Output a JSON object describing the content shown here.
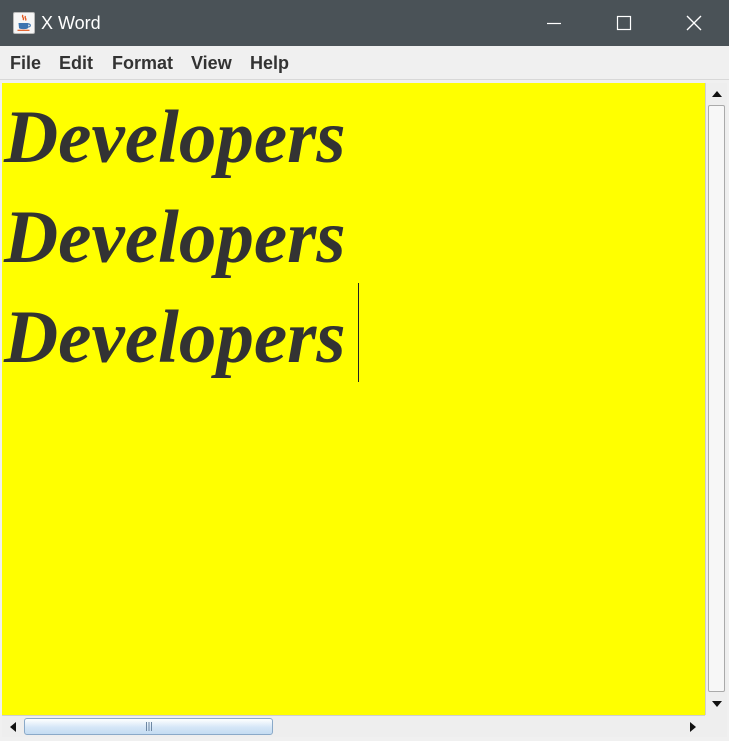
{
  "window": {
    "title": "X Word",
    "icon": "java-cup-icon"
  },
  "controls": {
    "minimize_icon": "minimize-icon",
    "maximize_icon": "maximize-icon",
    "close_icon": "close-icon"
  },
  "menu": {
    "items": [
      {
        "label": "File"
      },
      {
        "label": "Edit"
      },
      {
        "label": "Format"
      },
      {
        "label": "View"
      },
      {
        "label": "Help"
      }
    ]
  },
  "editor": {
    "background": "#ffff00",
    "text_color": "#333333",
    "lines": [
      "Developers",
      "Developers",
      "Developers"
    ]
  }
}
